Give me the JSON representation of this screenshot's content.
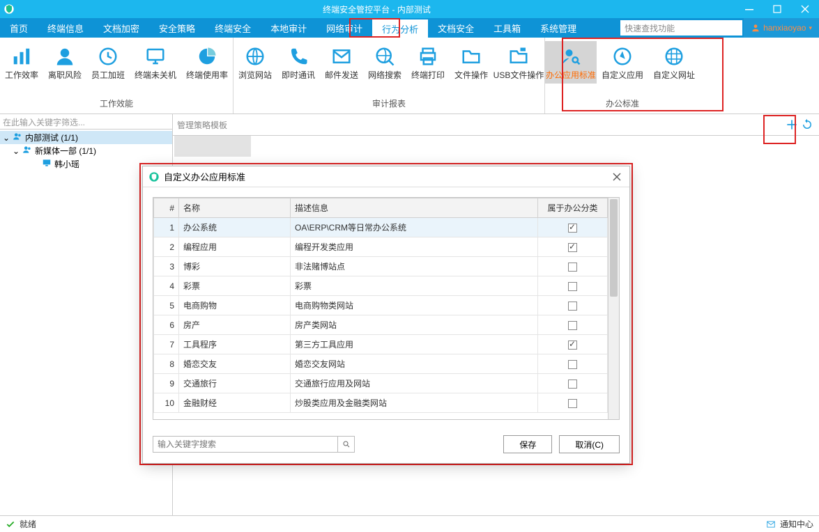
{
  "window": {
    "title": "终端安全管控平台 - 内部测试"
  },
  "user": {
    "name": "hanxiaoyao"
  },
  "search_placeholder": "快速查找功能",
  "menu": [
    "首页",
    "终端信息",
    "文档加密",
    "安全策略",
    "终端安全",
    "本地审计",
    "网络审计",
    "行为分析",
    "文档安全",
    "工具箱",
    "系统管理"
  ],
  "menu_active": 7,
  "ribbon": {
    "groups": [
      {
        "label": "工作效能",
        "items": [
          {
            "label": "工作效率",
            "icon": "bar-chart"
          },
          {
            "label": "离职风险",
            "icon": "user"
          },
          {
            "label": "员工加班",
            "icon": "clock"
          },
          {
            "label": "终端未关机",
            "icon": "monitor"
          },
          {
            "label": "终端使用率",
            "icon": "pie-chart"
          }
        ]
      },
      {
        "label": "审计报表",
        "items": [
          {
            "label": "浏览网站",
            "icon": "globe"
          },
          {
            "label": "即时通讯",
            "icon": "phone"
          },
          {
            "label": "邮件发送",
            "icon": "mail"
          },
          {
            "label": "网络搜索",
            "icon": "globe-search"
          },
          {
            "label": "终端打印",
            "icon": "printer"
          },
          {
            "label": "文件操作",
            "icon": "folder"
          },
          {
            "label": "USB文件操作",
            "icon": "usb"
          }
        ]
      },
      {
        "label": "办公标准",
        "items": [
          {
            "label": "办公应用标准",
            "icon": "user-search",
            "selected": true,
            "orange": true
          },
          {
            "label": "自定义应用",
            "icon": "compass"
          },
          {
            "label": "自定义网址",
            "icon": "globe-grid"
          }
        ]
      }
    ]
  },
  "sidebar": {
    "filter_placeholder": "在此输入关键字筛选...",
    "nodes": [
      {
        "label": "内部测试 (1/1)",
        "icon": "users",
        "sel": true,
        "expand": true
      },
      {
        "label": "新媒体一部 (1/1)",
        "icon": "users",
        "expand": true,
        "indent": 1
      },
      {
        "label": "韩小瑶",
        "icon": "monitor",
        "indent": 2
      }
    ]
  },
  "main": {
    "header": "管理策略模板"
  },
  "dialog": {
    "title": "自定义办公应用标准",
    "columns": {
      "num": "#",
      "name": "名称",
      "desc": "描述信息",
      "cat": "属于办公分类"
    },
    "rows": [
      {
        "n": 1,
        "name": "办公系统",
        "desc": "OA\\ERP\\CRM等日常办公系统",
        "chk": true,
        "sel": true
      },
      {
        "n": 2,
        "name": "编程应用",
        "desc": "编程开发类应用",
        "chk": true
      },
      {
        "n": 3,
        "name": "博彩",
        "desc": "非法赌博站点",
        "chk": false
      },
      {
        "n": 4,
        "name": "彩票",
        "desc": "彩票",
        "chk": false
      },
      {
        "n": 5,
        "name": "电商购物",
        "desc": "电商购物类网站",
        "chk": false
      },
      {
        "n": 6,
        "name": "房产",
        "desc": "房产类网站",
        "chk": false
      },
      {
        "n": 7,
        "name": "工具程序",
        "desc": "第三方工具应用",
        "chk": true
      },
      {
        "n": 8,
        "name": "婚恋交友",
        "desc": "婚恋交友网站",
        "chk": false
      },
      {
        "n": 9,
        "name": "交通旅行",
        "desc": "交通旅行应用及网站",
        "chk": false
      },
      {
        "n": 10,
        "name": "金融财经",
        "desc": "炒股类应用及金融类网站",
        "chk": false
      }
    ],
    "search_placeholder": "输入关键字搜索",
    "save": "保存",
    "cancel": "取消(C)"
  },
  "status": {
    "ready": "就绪",
    "notify": "通知中心"
  }
}
